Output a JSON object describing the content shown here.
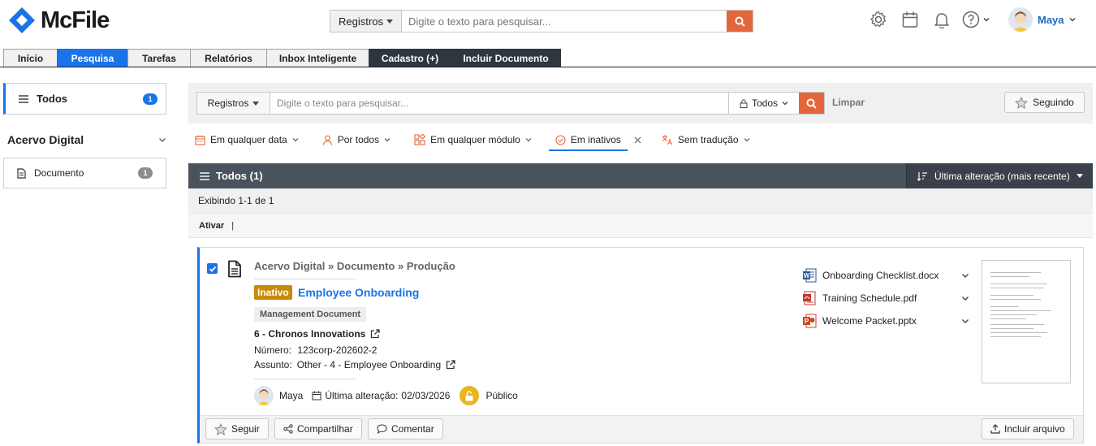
{
  "app": {
    "name": "McFile"
  },
  "header": {
    "search_scope": "Registros",
    "search_placeholder": "Digite o texto para pesquisar...",
    "user_name": "Maya",
    "icons": [
      "gear-icon",
      "calendar-icon",
      "bell-icon",
      "help-icon"
    ]
  },
  "tabs": [
    {
      "label": "Início"
    },
    {
      "label": "Pesquisa"
    },
    {
      "label": "Tarefas"
    },
    {
      "label": "Relatórios"
    },
    {
      "label": "Inbox Inteligente"
    },
    {
      "label": "Cadastro (+)"
    },
    {
      "label": "Incluir Documento"
    }
  ],
  "sidebar": {
    "todos_label": "Todos",
    "todos_count": "1",
    "section_title": "Acervo Digital",
    "items": [
      {
        "label": "Documento",
        "count": "1"
      }
    ]
  },
  "search": {
    "scope": "Registros",
    "placeholder": "Digite o texto para pesquisar...",
    "filter_scope": "Todos",
    "clear_label": "Limpar",
    "following_label": "Seguindo"
  },
  "filters": [
    {
      "label": "Em qualquer data",
      "icon": "calendar-icon"
    },
    {
      "label": "Por todos",
      "icon": "person-icon"
    },
    {
      "label": "Em qualquer módulo",
      "icon": "modules-icon"
    },
    {
      "label": "Em inativos",
      "icon": "check-circle-icon"
    },
    {
      "label": "Sem tradução",
      "icon": "translate-icon"
    }
  ],
  "results": {
    "header_title": "Todos (1)",
    "sort_label": "Última alteração (mais recente)",
    "showing": "Exibindo 1-1 de 1",
    "action_label": "Ativar",
    "action_separator": "|"
  },
  "record": {
    "breadcrumb": "Acervo Digital » Documento » Produção",
    "status": "Inativo",
    "title": "Employee Onboarding",
    "doc_type": "Management Document",
    "company": "6 - Chronos Innovations",
    "number_label": "Número:",
    "number_value": "123corp-202602-2",
    "subject_label": "Assunto:",
    "subject_value": "Other - 4 - Employee Onboarding",
    "author": "Maya",
    "modified_label": "Última alteração:",
    "modified_date": "02/03/2026",
    "visibility": "Público",
    "files": [
      {
        "name": "Onboarding Checklist.docx",
        "icon": "word-icon",
        "color": "#2b579a"
      },
      {
        "name": "Training Schedule.pdf",
        "icon": "pdf-icon",
        "color": "#c0392b"
      },
      {
        "name": "Welcome Packet.pptx",
        "icon": "powerpoint-icon",
        "color": "#d04423"
      }
    ],
    "actions": {
      "follow": "Seguir",
      "share": "Compartilhar",
      "comment": "Comentar",
      "add_file": "Incluir arquivo"
    }
  },
  "colors": {
    "accent": "#1a73e8",
    "search_button": "#e3663a",
    "inactive_badge": "#c98a0b",
    "results_header": "#4a525c",
    "dark_tab": "#2e3640",
    "lock_badge": "#e8b51c"
  }
}
